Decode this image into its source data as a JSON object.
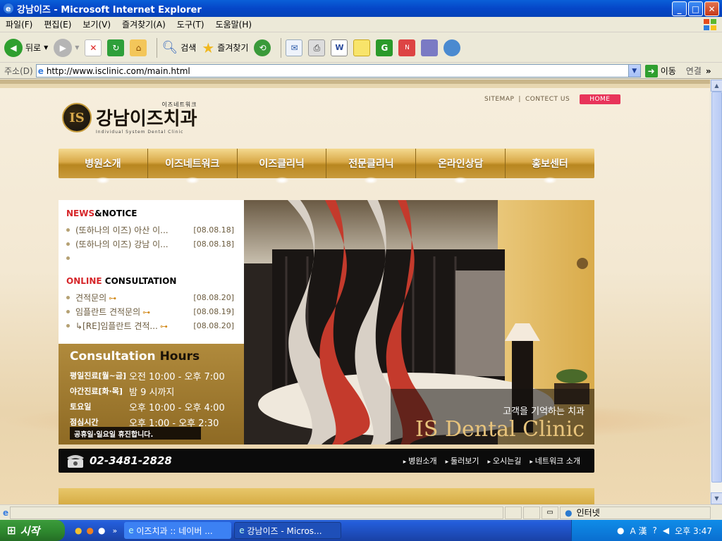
{
  "window": {
    "title": "강남이즈 - Microsoft Internet Explorer",
    "buttons": [
      "_",
      "□",
      "✕"
    ]
  },
  "menu": [
    "파일(F)",
    "편집(E)",
    "보기(V)",
    "즐겨찾기(A)",
    "도구(T)",
    "도움말(H)"
  ],
  "toolbar": {
    "back": "뒤로",
    "search": "검색",
    "favorites": "즐겨찾기"
  },
  "address": {
    "label": "주소(D)",
    "url": "http://www.isclinic.com/main.html",
    "go": "이동",
    "links": "연결"
  },
  "site": {
    "toplinks": [
      "SITEMAP",
      "CONTECT US"
    ],
    "home": "HOME",
    "logo": {
      "mark": "IS",
      "sub": "이즈네트워크",
      "main": "강남이즈치과",
      "eng": "Individual System Dental Clinic"
    },
    "nav": [
      "병원소개",
      "이즈네트워크",
      "이즈클리닉",
      "전문클리닉",
      "온라인상담",
      "홍보센터"
    ],
    "news": {
      "title_red": "NEWS",
      "title_rest": "&NOTICE",
      "items": [
        {
          "text": "(또하나의 이즈) 아산 이...",
          "date": "[08.08.18]"
        },
        {
          "text": "(또하나의 이즈) 강남 이...",
          "date": "[08.08.18]"
        },
        {
          "text": "",
          "date": ""
        }
      ]
    },
    "consult": {
      "title_red": "ONLINE",
      "title_rest": " CONSULTATION",
      "items": [
        {
          "text": "견적문의",
          "date": "[08.08.20]"
        },
        {
          "text": "임플란트 견적문의",
          "date": "[08.08.19]"
        },
        {
          "text": "↳[RE]임플란트 견적...",
          "date": "[08.08.20]"
        }
      ]
    },
    "hours": {
      "title_a": "Consultation",
      "title_b": "Hours",
      "rows": [
        {
          "label": "평일진료[월~금]",
          "value": "오전 10:00 - 오후 7:00"
        },
        {
          "label": "야간진료[화·목]",
          "value": "밤  9 시까지"
        },
        {
          "label": "토요일",
          "value": "오후 10:00 - 오후 4:00"
        },
        {
          "label": "점심시간",
          "value": "오후 1:00 - 오후 2:30"
        }
      ],
      "note": "공휴일·일요일 휴진합니다."
    },
    "photo_caption": {
      "ko": "고객을 기억하는 치과",
      "en": "IS Dental Clinic"
    },
    "contact": {
      "phone": "02-3481-2828",
      "links": [
        "병원소개",
        "둘러보기",
        "오시는길",
        "네트워크 소개"
      ]
    }
  },
  "status": {
    "zone": "인터넷"
  },
  "taskbar": {
    "start": "시작",
    "tasks": [
      "이즈치과 :: 네이버 ...",
      "강남이즈 - Micros..."
    ],
    "clock": "오후 3:47"
  },
  "colors": {
    "accent_red": "#d6262a",
    "home_btn": "#e8345a",
    "gold": "#c99b3c"
  }
}
